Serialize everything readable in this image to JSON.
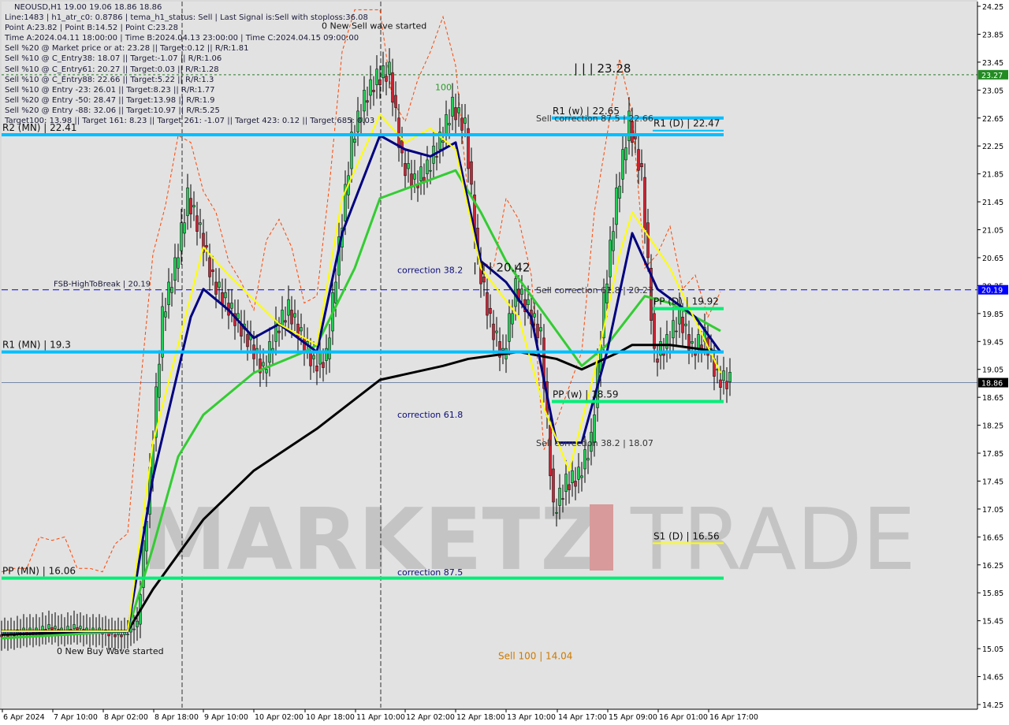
{
  "header": {
    "title": "NEOUSD,H1  19.00 19.06 18.86 18.86",
    "lines": [
      "Line:1483 | h1_atr_c0: 0.8786 | tema_h1_status: Sell | Last Signal is:Sell with stoploss:36.08",
      "Point A:23.82 | Point B:14.52 | Point C:23.28",
      "Time A:2024.04.11 18:00:00 | Time B:2024.04.13 23:00:00 | Time C:2024.04.15 09:00:00",
      "Sell %20 @ Market price or at: 23.28 || Target:0.12 || R/R:1.81",
      "Sell %10 @ C_Entry38: 18.07 || Target:-1.07 || R/R:1.06",
      "Sell %10 @ C_Entry61: 20.27 || Target:0.03 || R/R:1.28",
      "Sell %10 @ C_Entry88: 22.66 || Target:5.22 || R/R:1.3",
      "Sell %10 @ Entry -23: 26.01 || Target:8.23 || R/R:1.77",
      "Sell %20 @ Entry -50: 28.47 || Target:13.98 || R/R:1.9",
      "Sell %20 @ Entry -88: 32.06 || Target:10.97 || R/R:5.25",
      "Target100: 13.98 || Target 161: 8.23 || Target 261: -1.07 || Target 423: 0.12 || Target 685: 0.03"
    ]
  },
  "watermark": {
    "left": "MARKETZ",
    "mid": "I",
    "right": "TRADE"
  },
  "colors": {
    "background": "#d9d9d9",
    "bull": "#22cc55",
    "bear": "#cc2233",
    "pivot_cyan": "#00bfff",
    "pivot_green": "#00ee77",
    "fsb": "#0000ff",
    "ma_black": "#000000",
    "ma_green": "#33cc33",
    "ma_navy": "#000080",
    "ma_yellow": "#ffff00",
    "stop": "#ff4400"
  },
  "chart_data": {
    "type": "candlestick",
    "symbol": "NEOUSD",
    "timeframe": "H1",
    "ylim": [
      14.25,
      24.25
    ],
    "y_ticks": [
      "24.25",
      "23.85",
      "23.45",
      "23.05",
      "22.65",
      "22.25",
      "21.85",
      "21.45",
      "21.05",
      "20.65",
      "20.25",
      "19.85",
      "19.45",
      "19.05",
      "18.65",
      "18.25",
      "17.85",
      "17.45",
      "17.05",
      "16.65",
      "16.25",
      "15.85",
      "15.45",
      "15.05",
      "14.65",
      "14.25"
    ],
    "x_ticks": [
      "6 Apr 2024",
      "7 Apr 10:00",
      "8 Apr 02:00",
      "8 Apr 18:00",
      "9 Apr 10:00",
      "10 Apr 02:00",
      "10 Apr 18:00",
      "11 Apr 10:00",
      "12 Apr 02:00",
      "12 Apr 18:00",
      "13 Apr 10:00",
      "14 Apr 17:00",
      "15 Apr 09:00",
      "16 Apr 01:00",
      "16 Apr 17:00"
    ],
    "times": [
      "6 Apr 18:00",
      "6 Apr 22:00",
      "7 Apr 02:00",
      "7 Apr 06:00",
      "7 Apr 10:00",
      "7 Apr 14:00",
      "7 Apr 18:00",
      "7 Apr 22:00",
      "8 Apr 02:00",
      "8 Apr 06:00",
      "8 Apr 10:00",
      "8 Apr 14:00",
      "8 Apr 18:00",
      "8 Apr 22:00",
      "9 Apr 02:00",
      "9 Apr 06:00",
      "9 Apr 10:00",
      "9 Apr 14:00",
      "9 Apr 18:00",
      "9 Apr 22:00",
      "10 Apr 02:00",
      "10 Apr 06:00",
      "10 Apr 10:00",
      "10 Apr 14:00",
      "10 Apr 18:00",
      "10 Apr 22:00",
      "11 Apr 02:00",
      "11 Apr 06:00",
      "11 Apr 10:00",
      "11 Apr 14:00",
      "11 Apr 18:00",
      "11 Apr 22:00",
      "12 Apr 02:00",
      "12 Apr 06:00",
      "12 Apr 10:00",
      "12 Apr 14:00",
      "12 Apr 18:00",
      "12 Apr 22:00",
      "13 Apr 02:00",
      "13 Apr 06:00",
      "13 Apr 10:00",
      "13 Apr 14:00",
      "14 Apr 09:00",
      "14 Apr 13:00",
      "14 Apr 17:00",
      "14 Apr 21:00",
      "15 Apr 01:00",
      "15 Apr 05:00",
      "15 Apr 09:00",
      "15 Apr 13:00",
      "15 Apr 17:00",
      "15 Apr 21:00",
      "16 Apr 01:00",
      "16 Apr 05:00",
      "16 Apr 09:00",
      "16 Apr 13:00",
      "16 Apr 17:00",
      "16 Apr 21:00"
    ],
    "close": [
      15.25,
      15.3,
      15.3,
      15.35,
      15.3,
      15.35,
      15.3,
      15.3,
      15.25,
      15.25,
      15.4,
      17.5,
      19.8,
      20.5,
      21.5,
      21.0,
      20.3,
      20.0,
      19.7,
      19.4,
      19.0,
      19.6,
      19.9,
      19.5,
      19.1,
      19.2,
      20.8,
      22.3,
      22.9,
      23.2,
      23.3,
      22.0,
      21.7,
      21.9,
      22.3,
      22.8,
      22.5,
      20.6,
      19.7,
      19.2,
      20.2,
      19.9,
      19.5,
      17.0,
      17.4,
      17.5,
      18.0,
      20.0,
      21.5,
      22.6,
      21.8,
      19.2,
      19.4,
      19.8,
      19.3,
      19.5,
      18.9,
      18.86
    ],
    "indicator_lines": [
      {
        "color": "#000000",
        "knots": [
          [
            0,
            15.25
          ],
          [
            10,
            15.3
          ],
          [
            12,
            15.9
          ],
          [
            16,
            16.9
          ],
          [
            20,
            17.6
          ],
          [
            25,
            18.2
          ],
          [
            30,
            18.9
          ],
          [
            35,
            19.1
          ],
          [
            37,
            19.2
          ],
          [
            41,
            19.3
          ],
          [
            44,
            19.2
          ],
          [
            46,
            19.05
          ],
          [
            49,
            19.3
          ],
          [
            50,
            19.4
          ],
          [
            53,
            19.4
          ],
          [
            57,
            19.3
          ]
        ]
      },
      {
        "color": "#33cc33",
        "knots": [
          [
            0,
            15.2
          ],
          [
            10,
            15.3
          ],
          [
            12,
            16.5
          ],
          [
            14,
            17.8
          ],
          [
            16,
            18.4
          ],
          [
            20,
            19.0
          ],
          [
            24,
            19.3
          ],
          [
            25,
            19.4
          ],
          [
            28,
            20.5
          ],
          [
            30,
            21.5
          ],
          [
            33,
            21.7
          ],
          [
            36,
            21.9
          ],
          [
            38,
            21.3
          ],
          [
            40,
            20.6
          ],
          [
            42,
            20.1
          ],
          [
            44,
            19.6
          ],
          [
            46,
            19.1
          ],
          [
            48,
            19.4
          ],
          [
            51,
            20.1
          ],
          [
            53,
            20.0
          ],
          [
            57,
            19.6
          ]
        ]
      },
      {
        "color": "#000080",
        "knots": [
          [
            0,
            15.3
          ],
          [
            10,
            15.3
          ],
          [
            12,
            17.5
          ],
          [
            15,
            19.8
          ],
          [
            16,
            20.2
          ],
          [
            18,
            19.9
          ],
          [
            20,
            19.5
          ],
          [
            22,
            19.7
          ],
          [
            25,
            19.3
          ],
          [
            27,
            21.0
          ],
          [
            30,
            22.4
          ],
          [
            32,
            22.2
          ],
          [
            34,
            22.1
          ],
          [
            36,
            22.3
          ],
          [
            38,
            20.6
          ],
          [
            40,
            20.3
          ],
          [
            42,
            19.8
          ],
          [
            44,
            18.0
          ],
          [
            46,
            18.0
          ],
          [
            48,
            19.3
          ],
          [
            50,
            21.0
          ],
          [
            52,
            20.2
          ],
          [
            55,
            19.8
          ],
          [
            57,
            19.3
          ]
        ]
      },
      {
        "color": "#ffff00",
        "knots": [
          [
            0,
            15.3
          ],
          [
            10,
            15.3
          ],
          [
            12,
            18.0
          ],
          [
            16,
            20.8
          ],
          [
            18,
            20.4
          ],
          [
            22,
            19.7
          ],
          [
            25,
            19.4
          ],
          [
            27,
            21.5
          ],
          [
            30,
            22.7
          ],
          [
            32,
            22.3
          ],
          [
            34,
            22.5
          ],
          [
            36,
            22.2
          ],
          [
            38,
            20.5
          ],
          [
            41,
            19.8
          ],
          [
            43,
            18.5
          ],
          [
            45,
            17.6
          ],
          [
            47,
            19.0
          ],
          [
            49,
            20.7
          ],
          [
            50,
            21.3
          ],
          [
            53,
            20.5
          ],
          [
            57,
            19.0
          ]
        ]
      }
    ],
    "levels": [
      {
        "label": "R2 (MN) | 22.41",
        "value": 22.41,
        "color": "#00bfff",
        "from": 0
      },
      {
        "label": "R1 (MN) | 19.3",
        "value": 19.3,
        "color": "#00bfff",
        "from": 0
      },
      {
        "label": "PP (MN) | 16.06",
        "value": 16.06,
        "color": "#00ee77",
        "from": 0
      },
      {
        "label": "R1 (w) | 22.65",
        "value": 22.65,
        "color": "#00bfff",
        "from": 44
      },
      {
        "label": "PP (w) | 18.59",
        "value": 18.59,
        "color": "#00ee77",
        "from": 44
      },
      {
        "label": "R1 (D) | 22.47",
        "value": 22.47,
        "color": "#00bfff",
        "from": 52
      },
      {
        "label": "PP (D) | 19.92",
        "value": 19.92,
        "color": "#00ee77",
        "from": 52
      },
      {
        "label": "S1 (D) | 16.56",
        "value": 16.56,
        "color": "#ffff00",
        "from": 52
      }
    ],
    "fsb": {
      "label": "FSB-HighToBreak | 20.19",
      "value": 20.19
    },
    "current_price": 18.86,
    "point_c_line": 23.27,
    "price_tags": {
      "green": "23.27",
      "blue": "20.19",
      "black": "18.86"
    },
    "annotations": [
      {
        "text": "0 New Sell wave started",
        "t": 26,
        "y": 23.93
      },
      {
        "text": "0 New Buy Wave started",
        "t": 5,
        "y": 14.97
      },
      {
        "text": "correction 38.2",
        "t": 32,
        "y": 20.43
      },
      {
        "text": "correction 61.8",
        "t": 32,
        "y": 18.36
      },
      {
        "text": "correction 87.5",
        "t": 32,
        "y": 16.1
      },
      {
        "text": "Sell correction 87.5 | 22.66",
        "t": 43,
        "y": 22.6
      },
      {
        "text": "Sell correction 61.8 | 20.27",
        "t": 43,
        "y": 20.14
      },
      {
        "text": "Sell correction 38.2 | 18.07",
        "t": 43,
        "y": 17.95
      },
      {
        "text": "| | | 23.28",
        "t": 46,
        "y": 23.3
      },
      {
        "text": "| | | 20.42",
        "t": 38,
        "y": 20.45
      },
      {
        "text": "Sell 100 | 14.04",
        "t": 40,
        "y": 14.9
      },
      {
        "text": "100",
        "t": 35,
        "y": 23.05
      }
    ]
  }
}
